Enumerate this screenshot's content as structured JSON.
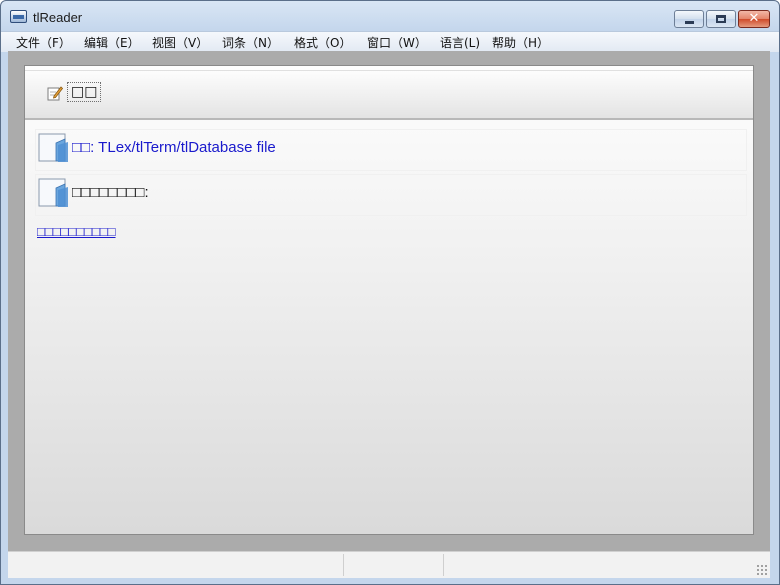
{
  "window": {
    "title": "tlReader",
    "close_glyph": "✕"
  },
  "menu": [
    {
      "label": "文件（F）"
    },
    {
      "label": "编辑（E）"
    },
    {
      "label": "视图（V）"
    },
    {
      "label": "词条（N）"
    },
    {
      "label": "格式（O）"
    },
    {
      "label": "窗口（W）"
    },
    {
      "label": "语言(L)"
    },
    {
      "label": "帮助（H）"
    }
  ],
  "toolbar": {
    "label": "□□",
    "icon": "edit-icon"
  },
  "content": {
    "file_row_text": "□□: TLex/tlTerm/tlDatabase file",
    "open_row_text": "□□□□□□□□:",
    "link_text": "□□□□□□□□□□"
  },
  "statusbar": {
    "panes": [
      "",
      "",
      ""
    ]
  },
  "colors": {
    "link": "#1a1acc",
    "client_bg": "#ababab"
  }
}
